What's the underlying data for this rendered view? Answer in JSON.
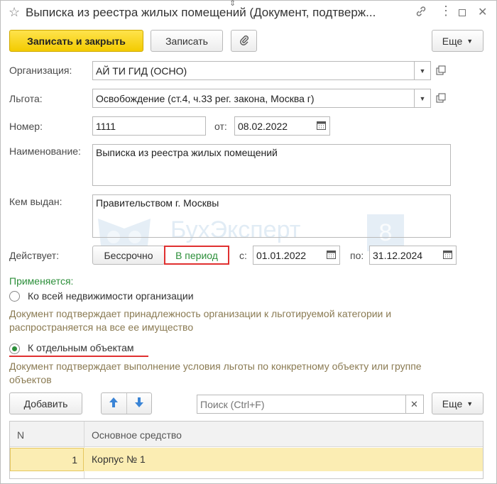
{
  "window": {
    "title": "Выписка из реестра жилых помещений (Документ, подтверж..."
  },
  "toolbar": {
    "save_close": "Записать и закрыть",
    "save": "Записать",
    "more": "Еще"
  },
  "form": {
    "org_label": "Организация:",
    "org_value": "АЙ ТИ ГИД (ОСНО)",
    "benefit_label": "Льгота:",
    "benefit_value": "Освобождение (ст.4, ч.33 рег. закона, Москва г)",
    "number_label": "Номер:",
    "number_value": "1111",
    "date_label": "от:",
    "date_value": "08.02.2022",
    "name_label": "Наименование:",
    "name_value": "Выписка из реестра жилых помещений",
    "issued_label": "Кем выдан:",
    "issued_value": "Правительством г. Москвы",
    "valid_label": "Действует:",
    "valid_indef": "Бессрочно",
    "valid_period": "В период",
    "from_label": "с:",
    "from_value": "01.01.2022",
    "to_label": "по:",
    "to_value": "31.12.2024"
  },
  "applies": {
    "header": "Применяется:",
    "option_all": "Ко всей недвижимости организации",
    "option_all_hint": "Документ подтверждает принадлежность организации к льготируемой категории и распространяется на все ее имущество",
    "option_selected": "К отдельным объектам",
    "option_selected_hint": "Документ подтверждает выполнение условия льготы по конкретному объекту или группе объектов"
  },
  "table_toolbar": {
    "add": "Добавить",
    "search_placeholder": "Поиск (Ctrl+F)",
    "more": "Еще"
  },
  "table": {
    "col_n": "N",
    "col_asset": "Основное средство",
    "rows": [
      {
        "n": "1",
        "asset": "Корпус № 1"
      }
    ]
  },
  "watermark": {
    "brand": "БухЭксперт",
    "digit": "8"
  },
  "colors": {
    "accent_yellow": "#f3cb00",
    "highlight_red": "#e03030",
    "hint_text": "#8a7a52",
    "green": "#2c8f3a",
    "row_selected": "#fbedb3"
  }
}
